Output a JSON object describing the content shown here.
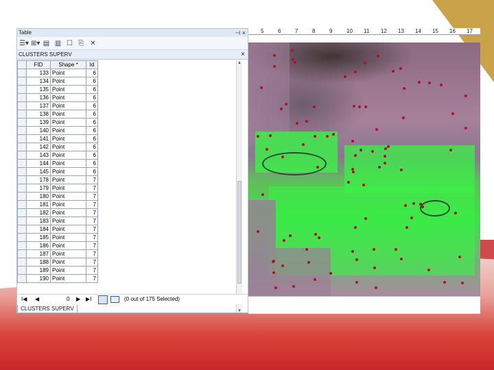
{
  "window": {
    "title": "Table",
    "layer_tab": "CLUSTERS SUPERV",
    "close_symbol": "×",
    "pin_symbol": "⊣ ×"
  },
  "table": {
    "columns": [
      "",
      "FID",
      "Shape *",
      "Id"
    ],
    "rows": [
      [
        "",
        "133",
        "Point",
        "6"
      ],
      [
        "",
        "134",
        "Point",
        "6"
      ],
      [
        "",
        "135",
        "Point",
        "6"
      ],
      [
        "",
        "136",
        "Point",
        "6"
      ],
      [
        "",
        "137",
        "Point",
        "6"
      ],
      [
        "",
        "138",
        "Point",
        "6"
      ],
      [
        "",
        "139",
        "Point",
        "6"
      ],
      [
        "",
        "140",
        "Point",
        "6"
      ],
      [
        "",
        "141",
        "Point",
        "6"
      ],
      [
        "",
        "142",
        "Point",
        "6"
      ],
      [
        "",
        "143",
        "Point",
        "6"
      ],
      [
        "",
        "144",
        "Point",
        "6"
      ],
      [
        "",
        "145",
        "Point",
        "6"
      ],
      [
        "",
        "178",
        "Point",
        "7"
      ],
      [
        "",
        "179",
        "Point",
        "7"
      ],
      [
        "",
        "180",
        "Point",
        "7"
      ],
      [
        "",
        "181",
        "Point",
        "7"
      ],
      [
        "",
        "182",
        "Point",
        "7"
      ],
      [
        "",
        "183",
        "Point",
        "7"
      ],
      [
        "",
        "184",
        "Point",
        "7"
      ],
      [
        "",
        "185",
        "Point",
        "7"
      ],
      [
        "",
        "186",
        "Point",
        "7"
      ],
      [
        "",
        "187",
        "Point",
        "7"
      ],
      [
        "",
        "188",
        "Point",
        "7"
      ],
      [
        "",
        "189",
        "Point",
        "7"
      ],
      [
        "",
        "190",
        "Point",
        "7"
      ]
    ]
  },
  "navigation": {
    "first": "I◀",
    "prev": "◀",
    "record": "0",
    "next": "▶",
    "last": "▶I",
    "status": "(0 out of 175 Selected)"
  },
  "bottom_tab": "CLUSTERS SUPERV",
  "ruler_ticks": [
    "5",
    "6",
    "7",
    "8",
    "9",
    "10",
    "11",
    "12",
    "13",
    "14",
    "15",
    "16",
    "17"
  ],
  "colors": {
    "selection_accent": "#2b5fb3",
    "map_point": "#b0102a",
    "vegetation": "#39f245"
  }
}
